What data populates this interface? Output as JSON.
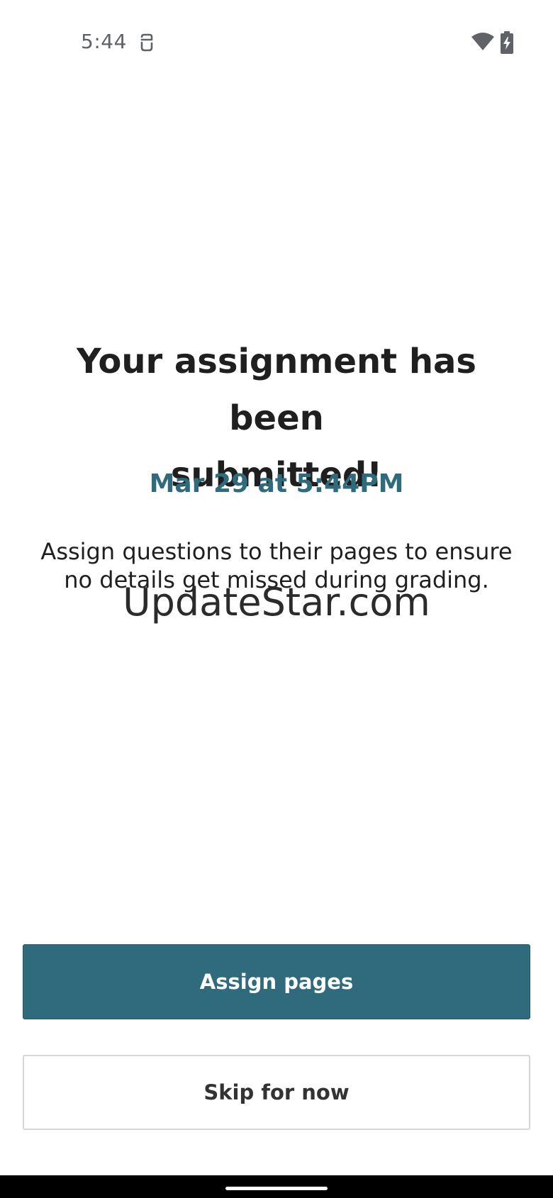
{
  "status_bar": {
    "time": "5:44",
    "app_icon": "notification-app-icon",
    "wifi_icon": "wifi-icon",
    "battery_icon": "battery-charging-icon"
  },
  "content": {
    "headline_line1": "Your assignment has been",
    "headline_line2": "submitted!",
    "submitted_at": "Mar 29 at 5:44PM",
    "description_line1": "Assign questions to their pages to ensure",
    "description_line2": "no details get missed during grading.",
    "watermark": "UpdateStar.com"
  },
  "actions": {
    "assign_label": "Assign pages",
    "skip_label": "Skip for now"
  },
  "colors": {
    "accent": "#2f6b7c",
    "text": "#1f1f1f",
    "border": "#d6d6d6"
  }
}
